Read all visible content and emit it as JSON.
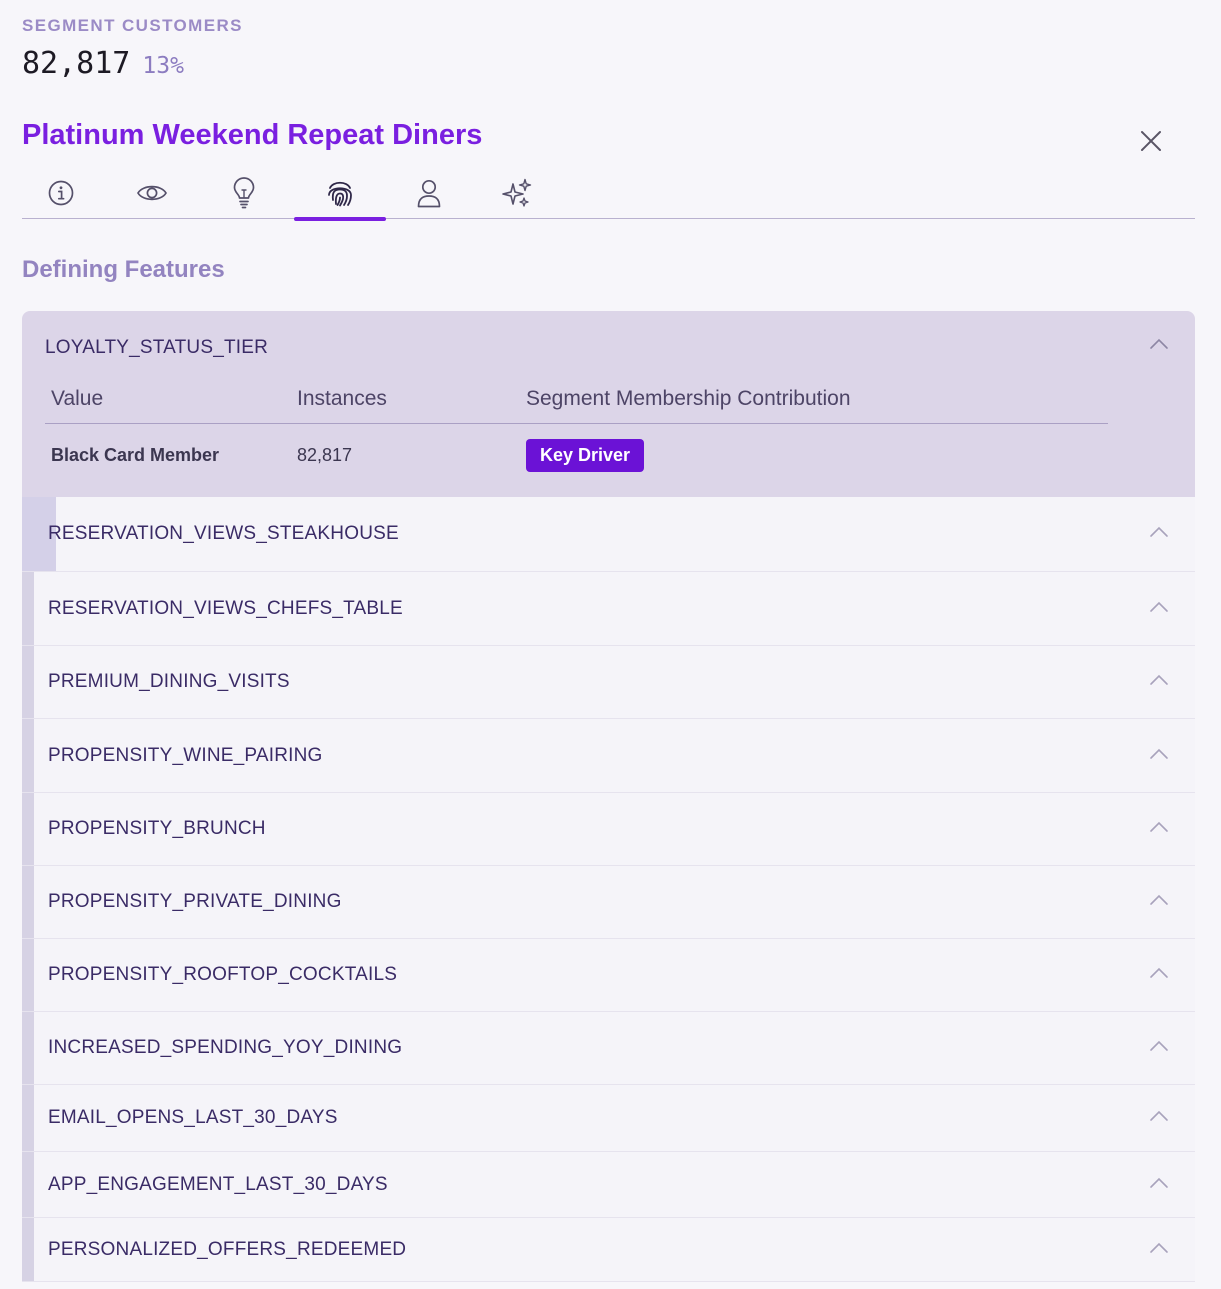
{
  "segment": {
    "label": "SEGMENT CUSTOMERS",
    "count": "82,817",
    "percent": "13%"
  },
  "title": "Platinum Weekend Repeat Diners",
  "tabs": [
    {
      "icon": "info-icon",
      "active": false
    },
    {
      "icon": "eye-icon",
      "active": false
    },
    {
      "icon": "lightbulb-icon",
      "active": false
    },
    {
      "icon": "fingerprint-icon",
      "active": true
    },
    {
      "icon": "user-icon",
      "active": false
    },
    {
      "icon": "sparkles-icon",
      "active": false
    }
  ],
  "section_heading": "Defining Features",
  "expanded_feature": {
    "name": "LOYALTY_STATUS_TIER",
    "columns": [
      "Value",
      "Instances",
      "Segment Membership Contribution"
    ],
    "rows": [
      {
        "value": "Black Card Member",
        "instances": "82,817",
        "contribution": "Key Driver"
      }
    ]
  },
  "features": [
    "RESERVATION_VIEWS_STEAKHOUSE",
    "RESERVATION_VIEWS_CHEFS_TABLE",
    "PREMIUM_DINING_VISITS",
    "PROPENSITY_WINE_PAIRING",
    "PROPENSITY_BRUNCH",
    "PROPENSITY_PRIVATE_DINING",
    "PROPENSITY_ROOFTOP_COCKTAILS",
    "INCREASED_SPENDING_YOY_DINING",
    "EMAIL_OPENS_LAST_30_DAYS",
    "APP_ENGAGEMENT_LAST_30_DAYS",
    "PERSONALIZED_OFFERS_REDEEMED"
  ],
  "colors": {
    "accent": "#7a1fe0",
    "badge": "#6b12d6",
    "expanded_bg": "#dcd5e8",
    "muted_label": "#9b8bc6"
  }
}
